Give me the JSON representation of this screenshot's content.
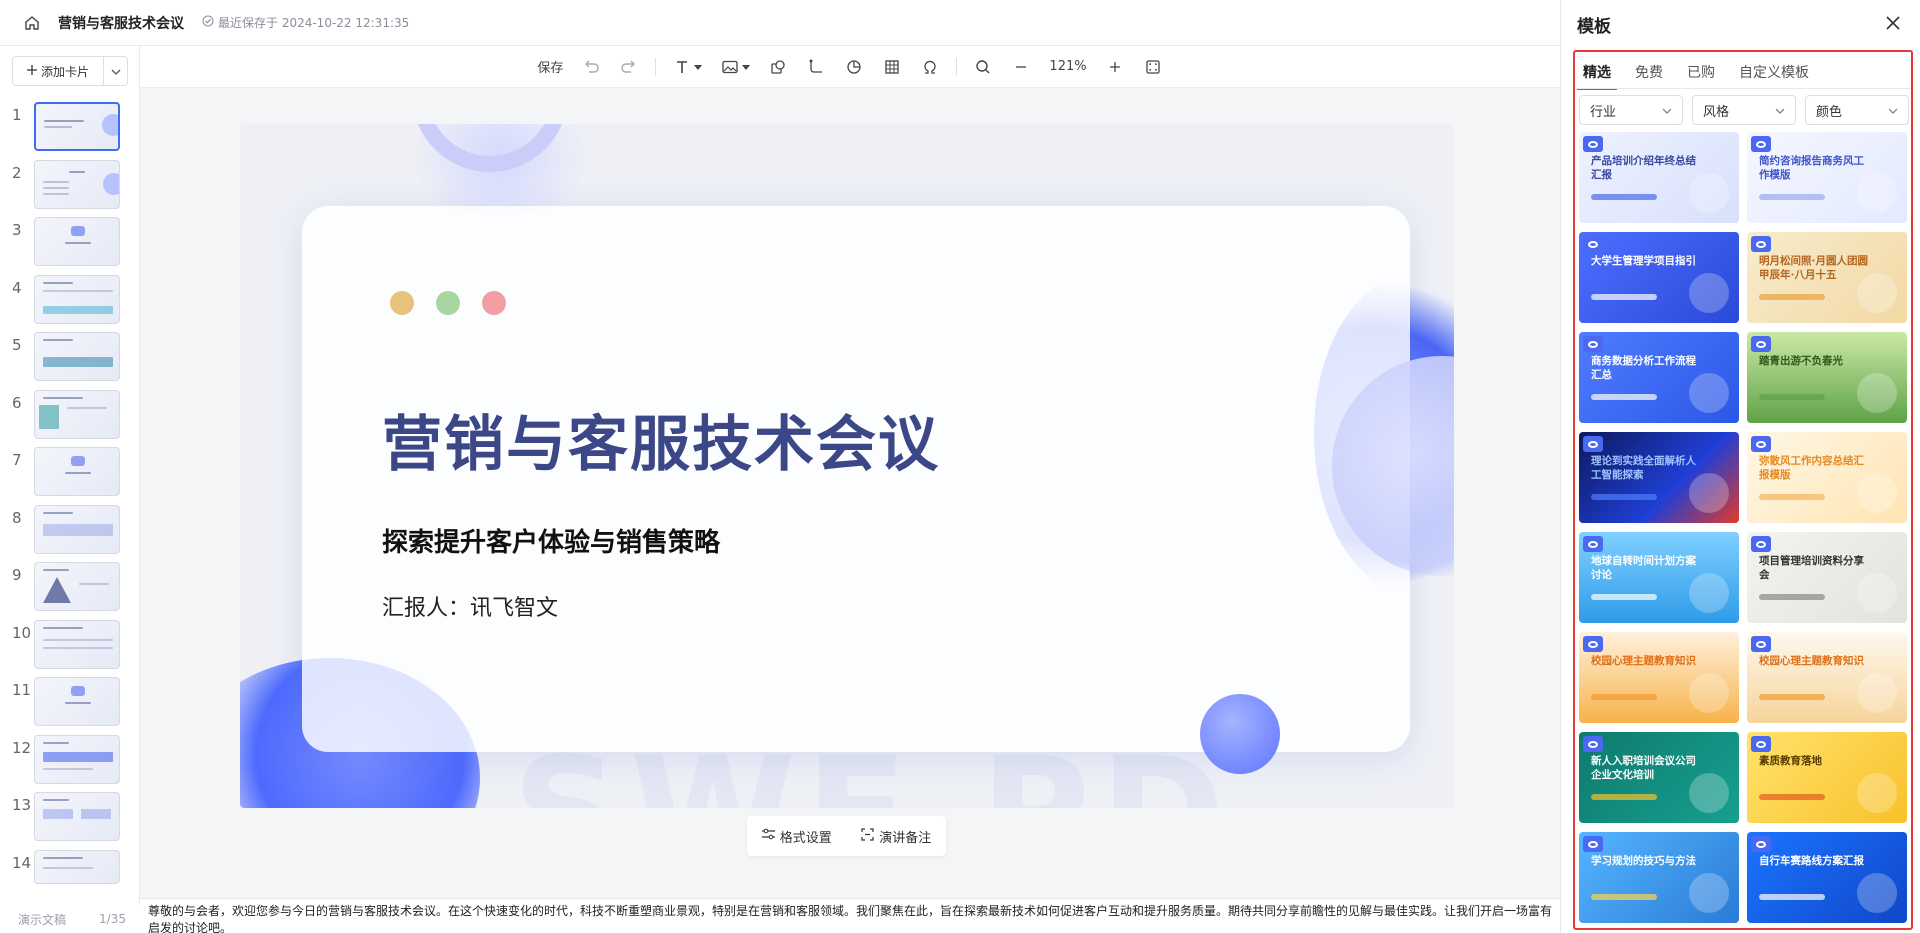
{
  "doc": {
    "title": "营销与客服技术会议",
    "save_status": "最近保存于 2024-10-22 12:31:35"
  },
  "left": {
    "add_card": "添加卡片",
    "slide_numbers": [
      "1",
      "2",
      "3",
      "4",
      "5",
      "6",
      "7",
      "8",
      "9",
      "10",
      "11",
      "12",
      "13",
      "14"
    ],
    "footer_label": "演示文稿",
    "footer_count": "1/35"
  },
  "toolbar": {
    "save": "保存",
    "zoom": "121%"
  },
  "slide": {
    "title": "营销与客服技术会议",
    "subtitle": "探索提升客户体验与销售策略",
    "reporter": "汇报人：讯飞智文",
    "dot_colors": [
      "#e7c27a",
      "#a6d7a0",
      "#f19da3"
    ]
  },
  "under": {
    "format": "格式设置",
    "notes": "演讲备注"
  },
  "notes_text": "尊敬的与会者，欢迎您参与今日的营销与客服技术会议。在这个快速变化的时代，科技不断重塑商业景观，特别是在营销和客服领域。我们聚焦在此，旨在探索最新技术如何促进客户互动和提升服务质量。期待共同分享前瞻性的见解与最佳实践。让我们开启一场富有启发的讨论吧。",
  "panel": {
    "title": "模板",
    "tabs": [
      "精选",
      "免费",
      "已购",
      "自定义模板"
    ],
    "filters": [
      "行业",
      "风格",
      "颜色"
    ],
    "templates": [
      {
        "title": "产品培训介绍年终总结汇报",
        "bg": "linear-gradient(135deg,#eef2ff,#d8e0fb)",
        "fg": "#3a47a0",
        "bar": "#4a68f0"
      },
      {
        "title": "简约咨询报告商务风工作模版",
        "bg": "linear-gradient(135deg,#f5f7ff,#e3e9ff)",
        "fg": "#3e55c9",
        "bar": "#9aa8f0"
      },
      {
        "title": "大学生管理学项目指引",
        "bg": "linear-gradient(135deg,#4d6fff,#2a49d8)",
        "fg": "#ffffff",
        "bar": "#ffffff"
      },
      {
        "title": "明月松间照·月圆人团圆 甲辰年·八月十五",
        "bg": "linear-gradient(135deg,#f7eccd,#f2d9a3)",
        "fg": "#b5651d",
        "bar": "#e8a33a"
      },
      {
        "title": "商务数据分析工作流程汇总",
        "bg": "linear-gradient(135deg,#4f7cff,#2b57e6)",
        "fg": "#ffffff",
        "bar": "#ffffff"
      },
      {
        "title": "踏青出游不负春光",
        "bg": "linear-gradient(180deg,#cbe8a6,#5ea348)",
        "fg": "#2e5c1e",
        "bar": "#5ea348"
      },
      {
        "title": "理论到实践全面解析人工智能探索",
        "bg": "linear-gradient(135deg,#0d1a5c,#1f3fd6 60%,#e03a2b)",
        "fg": "#9fc2ff",
        "bar": "#4f7cff"
      },
      {
        "title": "弥散风工作内容总结汇报模版",
        "bg": "linear-gradient(135deg,#fff7e6,#ffe4b3)",
        "fg": "#e58a1f",
        "bar": "#f4b55a"
      },
      {
        "title": "地球自转时间计划方案讨论",
        "bg": "linear-gradient(180deg,#7fd0ff,#2f9be8)",
        "fg": "#ffffff",
        "bar": "#ffffff"
      },
      {
        "title": "项目管理培训资料分享会",
        "bg": "linear-gradient(135deg,#f3f3f1,#e4e2dc)",
        "fg": "#333333",
        "bar": "#888888"
      },
      {
        "title": "校园心理主题教育知识",
        "bg": "linear-gradient(180deg,#fff1dc,#f7b24a)",
        "fg": "#e0701a",
        "bar": "#f39a2e"
      },
      {
        "title": "校园心理主题教育知识",
        "bg": "linear-gradient(180deg,#fff8ee,#f6d49a)",
        "fg": "#e0701a",
        "bar": "#f39a2e"
      },
      {
        "title": "新人入职培训会议公司企业文化培训",
        "bg": "linear-gradient(135deg,#0f7a6e,#16a08f)",
        "fg": "#ffffff",
        "bar": "#f2c230"
      },
      {
        "title": "素质教育落地",
        "bg": "linear-gradient(135deg,#ffe36b,#f8c12b)",
        "fg": "#5b3b00",
        "bar": "#e35b1c"
      },
      {
        "title": "学习规划的技巧与方法",
        "bg": "linear-gradient(135deg,#56b5ff,#2a7bd6)",
        "fg": "#ffffff",
        "bar": "#ffd54a"
      },
      {
        "title": "自行车赛路线方案汇报",
        "bg": "linear-gradient(135deg,#1b74ff,#1147c8)",
        "fg": "#ffffff",
        "bar": "#ffffff"
      }
    ]
  }
}
